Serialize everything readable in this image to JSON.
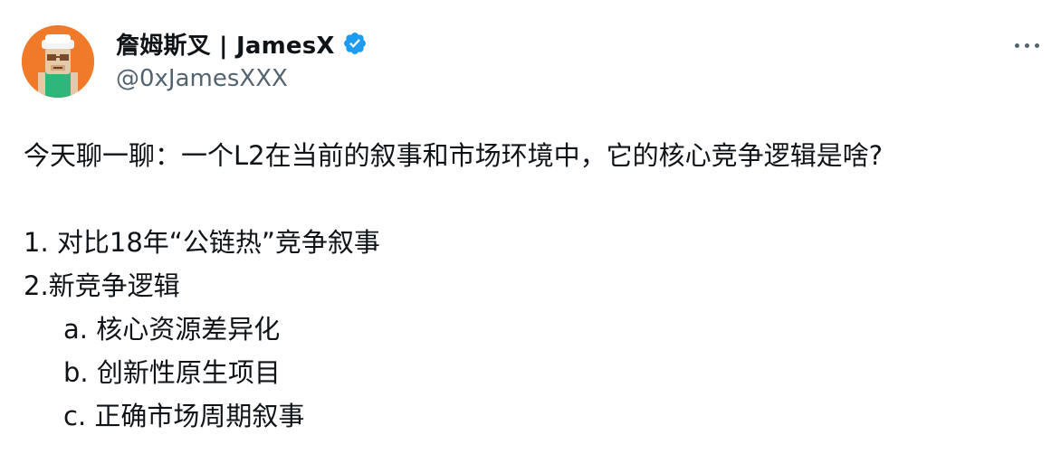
{
  "author": {
    "display_name": "詹姆斯叉 | JamesX",
    "handle": "@0xJamesXXX",
    "verified_icon": "verified-badge-icon",
    "avatar_icon": "cartoon-avatar",
    "verified_color": "#1d9bf0"
  },
  "menu": {
    "more_icon": "more-options-icon"
  },
  "tweet": {
    "intro": "今天聊一聊：一个L2在当前的叙事和市场环境中，它的核心竞争逻辑是啥?",
    "item1": "1. 对比18年“公链热”竞争叙事",
    "item2": "2.新竞争逻辑",
    "sub_a": "a. 核心资源差异化",
    "sub_b": "b. 创新性原生项目",
    "sub_c": "c. 正确市场周期叙事"
  }
}
